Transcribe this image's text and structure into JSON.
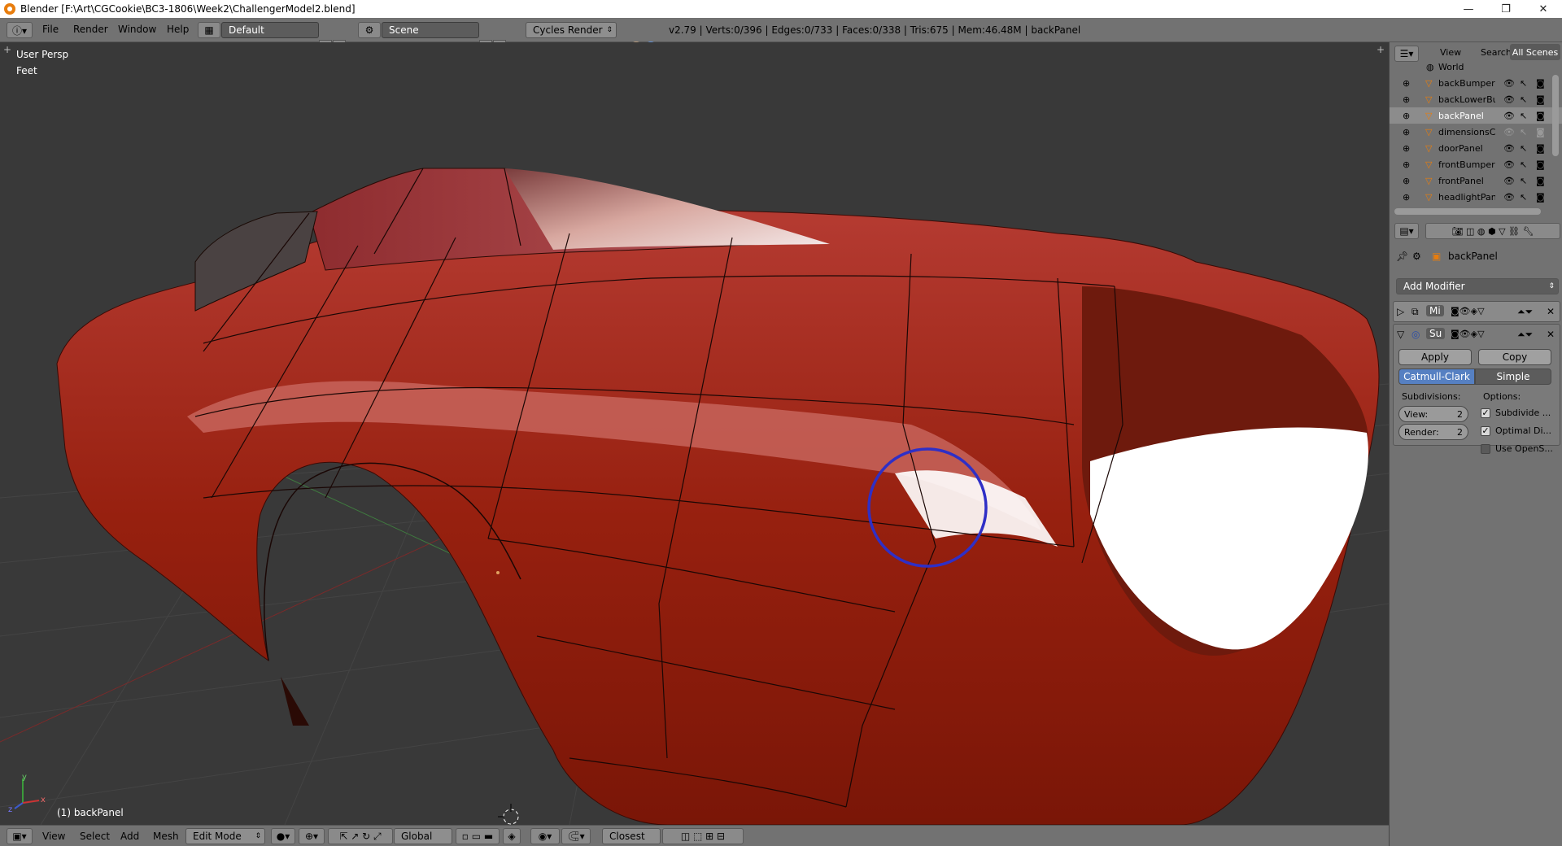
{
  "window": {
    "title": "Blender [F:\\Art\\CGCookie\\BC3-1806\\Week2\\ChallengerModel2.blend]",
    "minimize": "—",
    "maximize": "❐",
    "close": "✕"
  },
  "info_header": {
    "menus": [
      "File",
      "Render",
      "Window",
      "Help"
    ],
    "layout": "Default",
    "scene": "Scene",
    "engine": "Cycles Render",
    "stats": "v2.79 | Verts:0/396 | Edges:0/733 | Faces:0/338 | Tris:675 | Mem:46.48M | backPanel"
  },
  "viewport": {
    "view_name": "User Persp",
    "units": "Feet",
    "object_label": "(1) backPanel",
    "axis_x": "x",
    "axis_y": "y",
    "axis_z": "z",
    "colors": {
      "car": "#9a1f10",
      "background": "#393939",
      "highlight_circle": "#3333cc"
    }
  },
  "view3d_header": {
    "menus": [
      "View",
      "Select",
      "Add",
      "Mesh"
    ],
    "mode": "Edit Mode",
    "orientation": "Global",
    "snap": "Closest"
  },
  "outliner": {
    "tabs": [
      "View",
      "Search",
      "All Scenes"
    ],
    "items": [
      "World",
      "backBumperPa",
      "backLowerBum",
      "backPanel",
      "dimensionsChe",
      "doorPanel",
      "frontBumperPa",
      "frontPanel",
      "headlightPanel"
    ]
  },
  "properties": {
    "breadcrumb": "backPanel",
    "add_modifier": "Add Modifier",
    "modifier1_name": "Mi",
    "modifier2_name": "Su",
    "apply": "Apply",
    "copy": "Copy",
    "catmull": "Catmull-Clark",
    "simple": "Simple",
    "subdivisions_label": "Subdivisions:",
    "options_label": "Options:",
    "view_label": "View:",
    "view_value": "2",
    "render_label": "Render:",
    "render_value": "2",
    "opt1": "Subdivide ...",
    "opt2": "Optimal Di...",
    "opt3": "Use OpenS..."
  }
}
